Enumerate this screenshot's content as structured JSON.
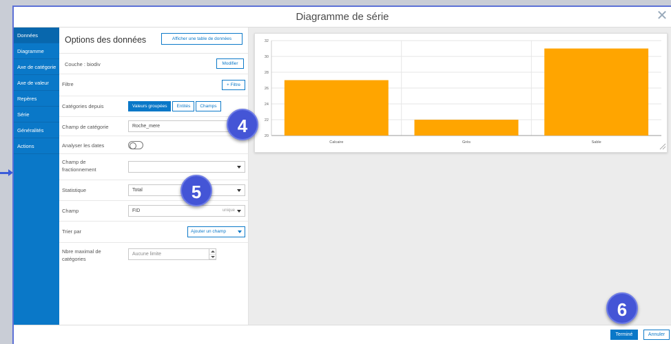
{
  "dialog": {
    "title": "Diagramme de série"
  },
  "sidebar": {
    "items": [
      {
        "label": "Données"
      },
      {
        "label": "Diagramme"
      },
      {
        "label": "Axe de catégorie"
      },
      {
        "label": "Axe de valeur"
      },
      {
        "label": "Repères"
      },
      {
        "label": "Série"
      },
      {
        "label": "Généralités"
      },
      {
        "label": "Actions"
      }
    ]
  },
  "options": {
    "title": "Options des données",
    "show_table_label": "Afficher une table de données",
    "layer_label": "Couche : biodiv",
    "modify_label": "Modifier",
    "filter_label": "Filtre",
    "add_filter_label": "+ Filtre",
    "categories_from_label": "Catégories depuis",
    "segments": [
      "Valeurs groupées",
      "Entités",
      "Champs"
    ],
    "category_field_label": "Champ de catégorie",
    "category_field_value": "Roche_mere",
    "analyze_dates_label": "Analyser les dates",
    "split_field_label_1": "Champ de",
    "split_field_label_2": "fractionnement",
    "statistic_label": "Statistique",
    "statistic_value": "Total",
    "field_label": "Champ",
    "field_value": "FID",
    "field_extra": "unique",
    "sort_by_label": "Trier par",
    "add_field_label": "Ajouter un champ",
    "max_categories_label_1": "Nbre maximal de",
    "max_categories_label_2": "catégories",
    "max_categories_value": "Aucune limite"
  },
  "footer": {
    "done_label": "Terminé",
    "cancel_label": "Annuler"
  },
  "badges": [
    "4",
    "5",
    "6"
  ],
  "colors": {
    "accent": "#0a78c8",
    "bar": "#ffa500",
    "badge": "#4455d6"
  },
  "chart_data": {
    "type": "bar",
    "categories": [
      "Calcaire",
      "Grès",
      "Sable"
    ],
    "values": [
      27,
      22,
      31
    ],
    "ylim": [
      20,
      32
    ],
    "yticks": [
      20,
      22,
      24,
      26,
      28,
      30,
      32
    ],
    "grid": true
  }
}
